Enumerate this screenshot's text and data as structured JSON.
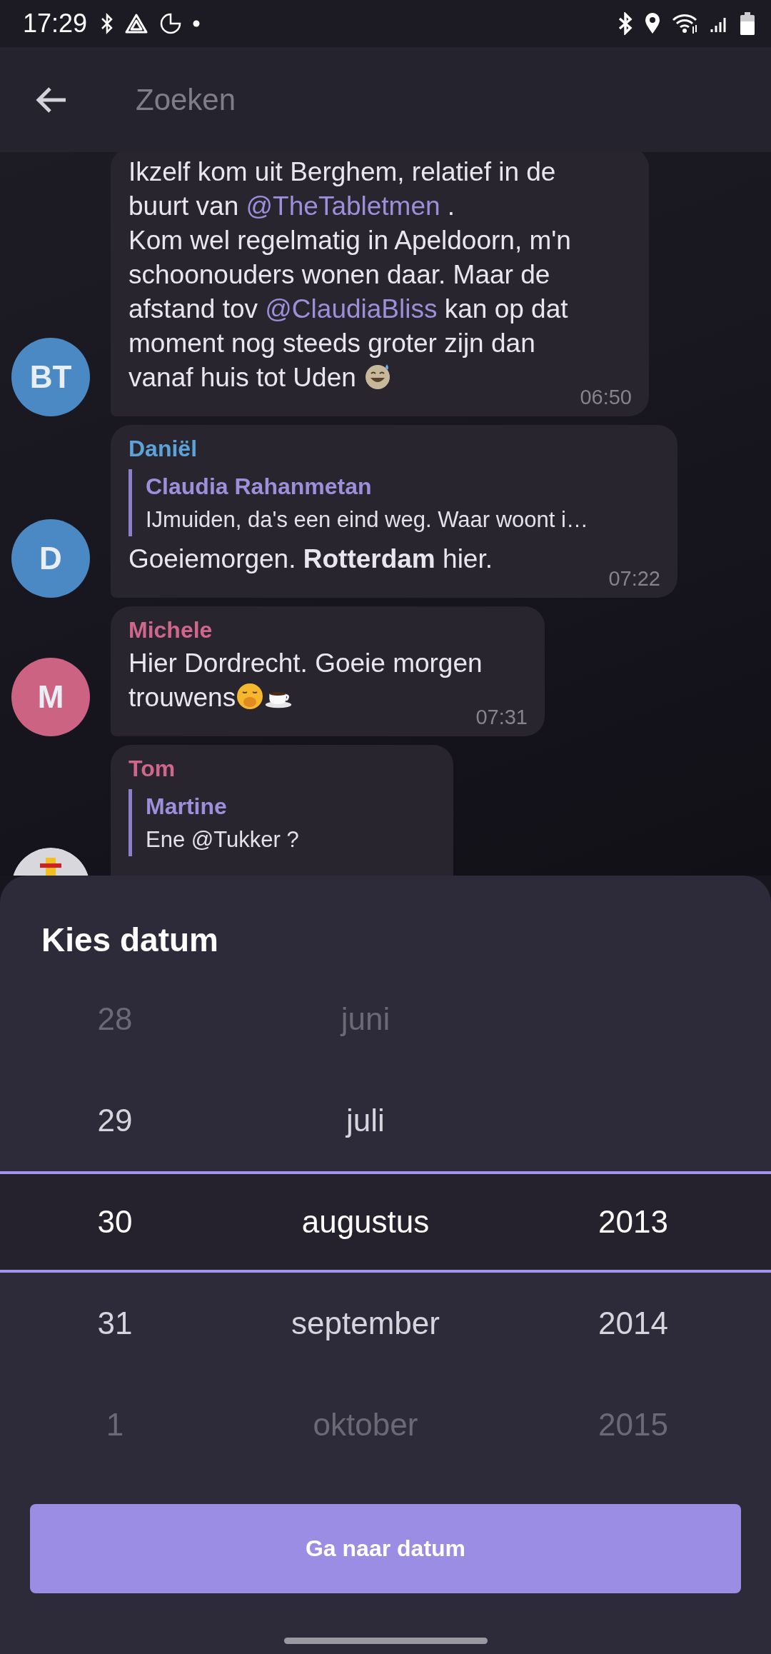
{
  "status_bar": {
    "time": "17:29"
  },
  "header": {
    "search": {
      "placeholder": "Zoeken"
    }
  },
  "messages": [
    {
      "avatar": {
        "kind": "initials",
        "initials": "BT",
        "color": "#4a89c3"
      },
      "paragraphs": [
        [
          {
            "kind": "text",
            "text": "Ikzelf kom uit Berghem, relatief in de buurt van "
          },
          {
            "kind": "mention",
            "text": "@TheTabletmen"
          },
          {
            "kind": "text",
            "text": " ."
          }
        ],
        [
          {
            "kind": "text",
            "text": "Kom wel regelmatig in Apeldoorn, m'n schoonouders wonen daar. Maar de afstand tov "
          },
          {
            "kind": "mention",
            "text": "@ClaudiaBliss"
          },
          {
            "kind": "text",
            "text": " kan op dat moment nog steeds groter zijn dan vanaf huis tot Uden "
          },
          {
            "kind": "sweat"
          }
        ]
      ],
      "time": "06:50"
    },
    {
      "avatar": {
        "kind": "initials",
        "initials": "D",
        "color": "#4a89c3"
      },
      "sender": {
        "name": "Daniël",
        "color": "#5ba3d8"
      },
      "reply": {
        "name": "Claudia Rahanmetan",
        "text": "IJmuiden, da's een eind weg. Waar woont i…"
      },
      "paragraphs": [
        [
          {
            "kind": "text",
            "text": "Goeiemorgen. **Rotterdam** hier."
          }
        ]
      ],
      "time": "07:22"
    },
    {
      "avatar": {
        "kind": "initials",
        "initials": "M",
        "color": "#cc6383"
      },
      "sender": {
        "name": "Michele",
        "color": "#d0678a"
      },
      "paragraphs": [
        [
          {
            "kind": "text",
            "text": "Hier Dordrecht. Goeie morgen trouwens"
          },
          {
            "kind": "yawn"
          },
          {
            "kind": "coffee"
          }
        ]
      ],
      "time": "07:31"
    },
    {
      "sender": {
        "name": "Tom",
        "color": "#d0678a"
      },
      "reply": {
        "name": "Martine",
        "text": "Ene @Tukker ?"
      }
    }
  ],
  "picker": {
    "title": "Kies datum",
    "rows": [
      {
        "day": "28",
        "month": "juni",
        "selected": false
      },
      {
        "day": "29",
        "month": "juli",
        "selected": false
      },
      {
        "day": "30",
        "month": "augustus",
        "year": "2013",
        "selected": true
      },
      {
        "day": "31",
        "month": "september",
        "year": "2014",
        "selected": false
      },
      {
        "day": "1",
        "month": "oktober",
        "year": "2015",
        "selected": false
      }
    ],
    "button": "Ga naar datum"
  }
}
